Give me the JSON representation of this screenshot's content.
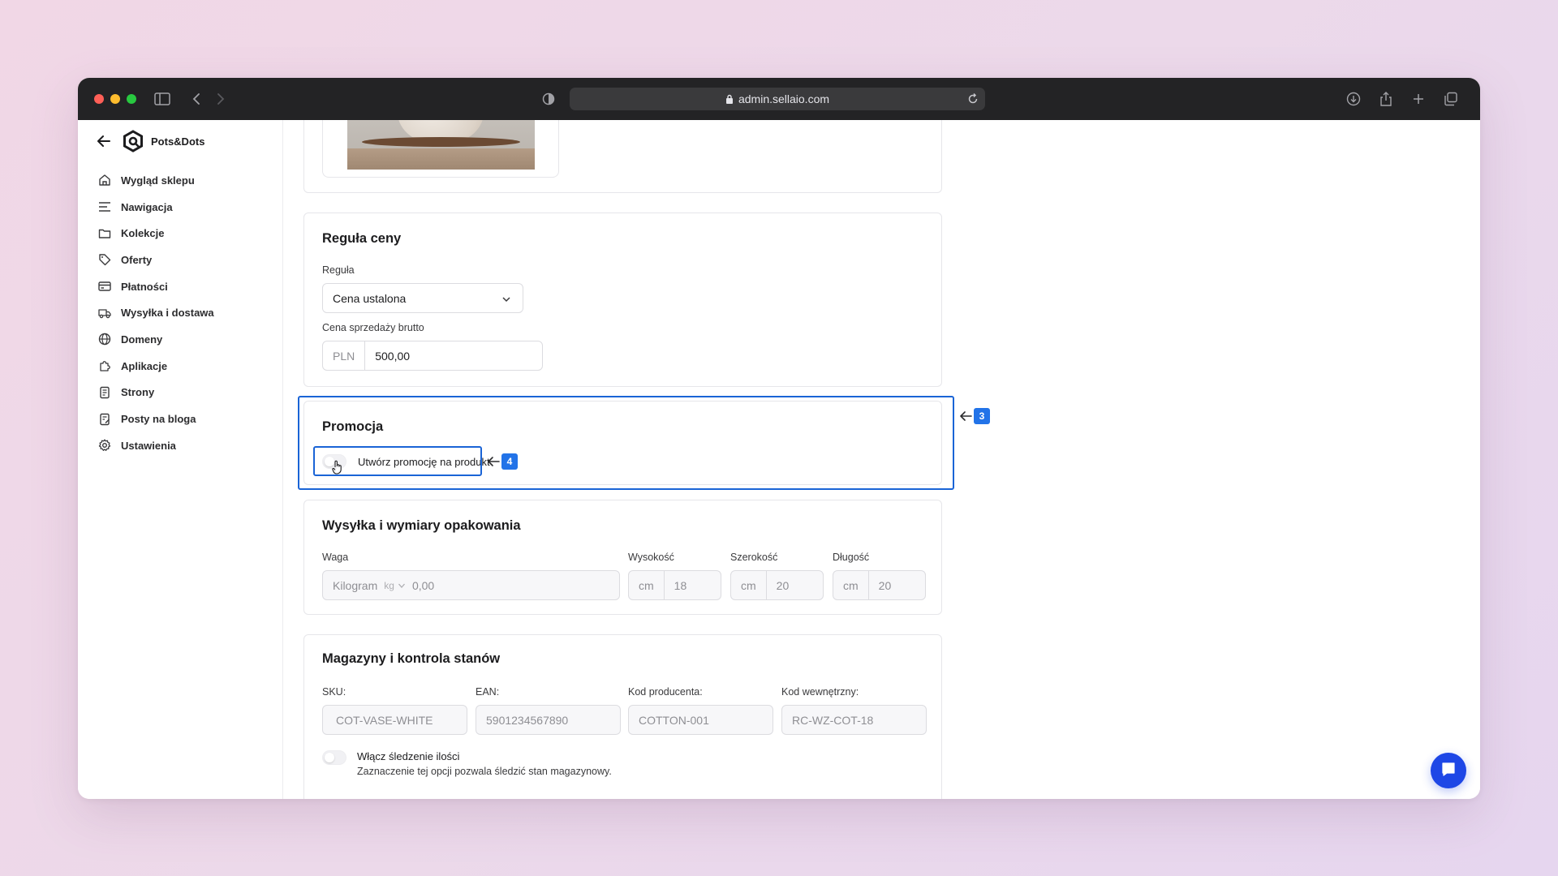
{
  "browser": {
    "url": "admin.sellaio.com",
    "traffic_colors": [
      "#ff5f57",
      "#febc2e",
      "#28c840"
    ]
  },
  "sidebar": {
    "brand_name": "Pots&Dots",
    "items": [
      {
        "label": "Wygląd sklepu",
        "icon": "home-icon"
      },
      {
        "label": "Nawigacja",
        "icon": "menu-lines-icon"
      },
      {
        "label": "Kolekcje",
        "icon": "folder-icon"
      },
      {
        "label": "Oferty",
        "icon": "tag-icon"
      },
      {
        "label": "Płatności",
        "icon": "credit-card-icon"
      },
      {
        "label": "Wysyłka i dostawa",
        "icon": "truck-icon"
      },
      {
        "label": "Domeny",
        "icon": "globe-icon"
      },
      {
        "label": "Aplikacje",
        "icon": "puzzle-icon"
      },
      {
        "label": "Strony",
        "icon": "document-icon"
      },
      {
        "label": "Posty na bloga",
        "icon": "blog-post-icon"
      },
      {
        "label": "Ustawienia",
        "icon": "gear-icon"
      }
    ]
  },
  "price_rule": {
    "title": "Reguła ceny",
    "rule_label": "Reguła",
    "rule_value": "Cena ustalona",
    "gross_label": "Cena sprzedaży brutto",
    "currency": "PLN",
    "gross_value": "500,00"
  },
  "promotion": {
    "title": "Promocja",
    "toggle_label": "Utwórz promocję na produkt",
    "annotation_card": "3",
    "annotation_toggle": "4"
  },
  "shipping": {
    "title": "Wysyłka i wymiary opakowania",
    "weight_label": "Waga",
    "weight_unit": "Kilogram",
    "weight_unit_short": "kg",
    "weight_value": "0,00",
    "height_label": "Wysokość",
    "height_unit": "cm",
    "height_value": "18",
    "width_label": "Szerokość",
    "width_unit": "cm",
    "width_value": "20",
    "length_label": "Długość",
    "length_unit": "cm",
    "length_value": "20"
  },
  "inventory": {
    "title": "Magazyny i kontrola stanów",
    "sku_label": "SKU:",
    "sku_value": "COT-VASE-WHITE",
    "ean_label": "EAN:",
    "ean_value": "5901234567890",
    "producer_label": "Kod producenta:",
    "producer_value": "COTTON-001",
    "internal_label": "Kod wewnętrzny:",
    "internal_value": "RC-WZ-COT-18",
    "tracking_label": "Włącz śledzenie ilości",
    "tracking_desc": "Zaznaczenie tej opcji pozwala śledzić stan magazynowy."
  },
  "colors": {
    "accent": "#1a64d6",
    "badge": "#2273e8",
    "chat": "#1e47e6"
  }
}
